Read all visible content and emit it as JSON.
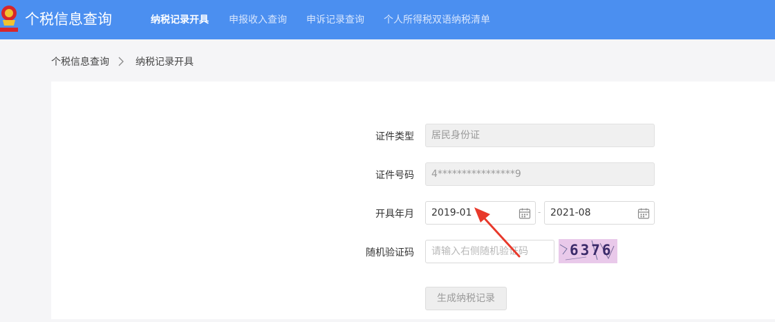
{
  "header": {
    "brand": "个税信息查询",
    "nav": [
      "纳税记录开具",
      "申报收入查询",
      "申诉记录查询",
      "个人所得税双语纳税清单"
    ],
    "active_index": 0
  },
  "breadcrumb": [
    "个税信息查询",
    "纳税记录开具"
  ],
  "form": {
    "id_type": {
      "label": "证件类型",
      "value": "居民身份证"
    },
    "id_number": {
      "label": "证件号码",
      "value": "4****************9"
    },
    "date_range": {
      "label": "开具年月",
      "start": "2019-01",
      "end": "2021-08",
      "separator": "-"
    },
    "captcha": {
      "label": "随机验证码",
      "placeholder": "请输入右侧随机验证码",
      "image_code": "6376"
    },
    "submit_label": "生成纳税记录"
  },
  "colors": {
    "header_bg": "#4b8ff0",
    "annotation_arrow": "#e8392b"
  }
}
